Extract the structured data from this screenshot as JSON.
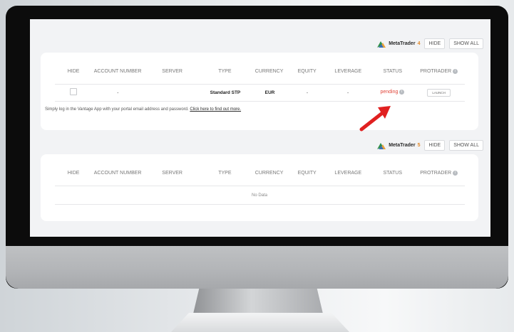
{
  "mt4": {
    "logo_text": "MetaTrader",
    "version": "4",
    "hide_label": "HIDE",
    "show_all_label": "SHOW ALL"
  },
  "mt5": {
    "logo_text": "MetaTrader",
    "version": "5",
    "hide_label": "HIDE",
    "show_all_label": "SHOW ALL"
  },
  "table1": {
    "columns": [
      "HIDE",
      "ACCOUNT NUMBER",
      "SERVER",
      "TYPE",
      "CURRENCY",
      "EQUITY",
      "LEVERAGE",
      "STATUS",
      "PROTRADER"
    ],
    "row": {
      "account_number": "-",
      "server": "",
      "type": "Standard STP",
      "currency": "EUR",
      "equity": "-",
      "leverage": "-",
      "status": "pending",
      "action": "LAUNCH"
    },
    "note": "Simply log in the Vantage App with your portal email address and password.",
    "note_link": "Click here to find out more."
  },
  "table2": {
    "columns": [
      "HIDE",
      "ACCOUNT NUMBER",
      "SERVER",
      "TYPE",
      "CURRENCY",
      "EQUITY",
      "LEVERAGE",
      "STATUS",
      "PROTRADER"
    ],
    "empty_text": "No Data"
  },
  "colors": {
    "pending": "#e1463a",
    "arrow": "#e02020",
    "mt_version": "#e38a2b"
  }
}
